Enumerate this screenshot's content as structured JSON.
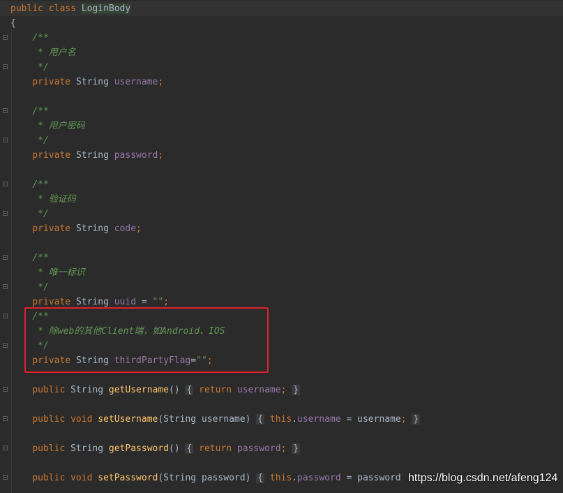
{
  "code": {
    "l1_kw1": "public",
    "l1_kw2": "class",
    "l1_class": "LoginBody",
    "open_brace": "{",
    "c1_open": "/**",
    "c1_text": " * 用户名",
    "c1_close": " */",
    "f1_kw": "private",
    "f1_type": "String",
    "f1_name": "username",
    "c2_text": " * 用户密码",
    "f2_name": "password",
    "c3_text": " * 验证码",
    "f3_name": "code",
    "c4_text": " * 唯一标识",
    "f4_name": "uuid",
    "f4_eq": " = ",
    "f4_val": "\"\"",
    "c5_text": " * 除web的其他Client端，如Android、IOS",
    "f5_name": "thirdPartyFlag",
    "f5_eq": "=",
    "f5_val": "\"\"",
    "semi": ";",
    "m1_kw": "public",
    "m1_type": "String",
    "m1_name": "getUsername",
    "m1_sig": "()",
    "m1_body_kw": "return",
    "m1_body_field": "username",
    "m2_type": "void",
    "m2_name": "setUsername",
    "m2_sig": "(String username)",
    "this_kw": "this",
    "dot": ".",
    "m2_field": "username",
    "m2_rhs": " = username",
    "m3_name": "getPassword",
    "m3_field": "password",
    "m4_name": "setPassword",
    "m4_sig": "(String password)",
    "m4_field": "password",
    "m4_rhs": " = password",
    "lbrace": "{",
    "rbrace": "}"
  },
  "watermark": "https://blog.csdn.net/afeng124",
  "colors": {
    "background": "#2b2b2b",
    "keyword": "#cc7832",
    "field": "#9876aa",
    "comment": "#629755",
    "method": "#ffc66d",
    "highlight_box": "#e0202a"
  }
}
